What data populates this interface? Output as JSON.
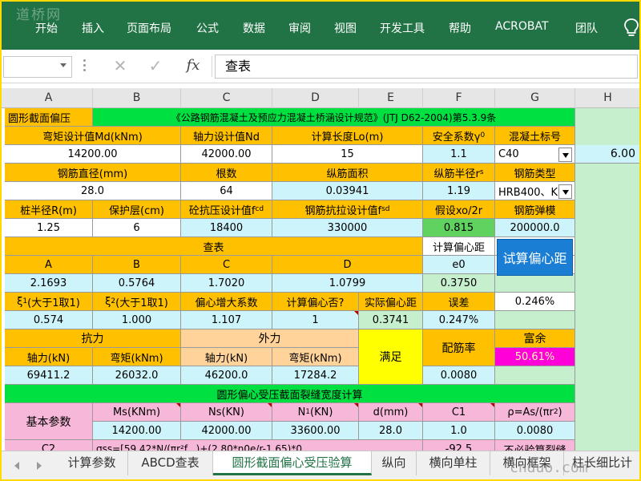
{
  "ribbon": {
    "watermark": "道桥网",
    "tabs": [
      "开始",
      "插入",
      "页面布局",
      "公式",
      "数据",
      "审阅",
      "视图",
      "开发工具",
      "帮助",
      "ACROBAT",
      "团队"
    ]
  },
  "formula_bar": {
    "name_box": "",
    "cancel_icon": "✕",
    "enter_icon": "✓",
    "fx_label": "fx",
    "formula": "查表"
  },
  "columns": [
    "A",
    "B",
    "C",
    "D",
    "E",
    "F",
    "G",
    "H"
  ],
  "cells": {
    "r1": {
      "a": "圆形截面偏压",
      "title": "《公路钢筋混凝土及预应力混凝土桥涵设计规范》(JTJ D62-2004)第5.3.9条"
    },
    "r2": {
      "a": "弯矩设计值Md(kNm)",
      "c": "轴力设计值Nd",
      "d": "计算长度Lo(m)",
      "f": "安全系数γ",
      "f_sub": "0",
      "g": "混凝土标号"
    },
    "r3": {
      "a": "14200.00",
      "c": "42000.00",
      "d": "15",
      "f": "1.1",
      "g": "C40",
      "h": "6.00"
    },
    "r4": {
      "a": "钢筋直径(mm)",
      "c": "根数",
      "d": "纵筋面积",
      "f": "纵筋半径r",
      "f_sub": "s",
      "g": "钢筋类型"
    },
    "r5": {
      "a": "28.0",
      "c": "64",
      "d": "0.03941",
      "f": "1.19",
      "g": "HRB400、K"
    },
    "r6": {
      "a": "桩半径R(m)",
      "b": "保护层(cm)",
      "c": "砼抗压设计值f",
      "c_sub": "cd",
      "d": "钢筋抗拉设计值f",
      "d_sub": "sd",
      "f": "假设xo/2r",
      "g": "钢筋弹模"
    },
    "r7": {
      "a": "1.25",
      "b": "6",
      "c": "18400",
      "d": "330000",
      "f": "0.815",
      "g": "200000.0"
    },
    "r8": {
      "a": "查表",
      "f": "计算偏心距"
    },
    "r9": {
      "a": "A",
      "b": "B",
      "c": "C",
      "d": "D",
      "f": "e0"
    },
    "r10": {
      "a": "2.1693",
      "b": "0.5764",
      "c": "1.7020",
      "d": "1.0799",
      "f": "0.3750"
    },
    "r11": {
      "a": "ξ",
      "a_sub": "1",
      "a_tail": "(大于1取1)",
      "b": "ξ",
      "b_sub": "2",
      "b_tail": "(大于1取1)",
      "c": "偏心增大系数",
      "d": "计算偏心否?",
      "e": "实际偏心距",
      "f": "误差",
      "g": "0.246%"
    },
    "r12": {
      "a": "0.574",
      "b": "1.000",
      "c": "1.107",
      "d": "1",
      "e": "0.3741",
      "f": "0.247%"
    },
    "r13": {
      "a": "抗力",
      "c": "外力",
      "e": "满足",
      "f": "配筋率",
      "g": "富余"
    },
    "r14": {
      "a": "轴力(kN)",
      "b": "弯矩(kNm)",
      "c": "轴力(kN)",
      "d": "弯矩(kNm)",
      "g": "50.61%"
    },
    "r15": {
      "a": "69411.2",
      "b": "26032.0",
      "c": "46200.0",
      "d": "17284.2",
      "f": "0.0080"
    },
    "r16": {
      "a": "圆形偏心受压截面裂缝宽度计算"
    },
    "r17": {
      "a": "基本参数",
      "b": "Ms(KNm)",
      "c": "Ns(KN)",
      "d": "N",
      "d_sub": "1",
      "d_tail": "(KN)",
      "e": "d(mm)",
      "f": "C1",
      "g": "ρ=As/(πr",
      "g_sup": "2",
      "g_tail": ")"
    },
    "r18": {
      "b": "14200.00",
      "c": "42000.00",
      "d": "33600.00",
      "e": "28.0",
      "f": "1.0",
      "g": "0.0080"
    },
    "r19": {
      "a": "C2",
      "b": "σss=[59.42*N/(πr²f...)+(2.80*η0e/r-1.65)*0.",
      "f": "-92.5",
      "g": "不必验算裂缝"
    }
  },
  "button": {
    "label": "试算偏心距"
  },
  "sheet_tabs": [
    "计算参数",
    "ABCD查表",
    "圆形截面偏心受压验算",
    "纵向",
    "横向单柱",
    "横向框架",
    "柱长细比计"
  ],
  "active_sheet": "圆形截面偏心受压验算",
  "site_watermark": "cnduo.com",
  "colors": {
    "ribbon": "#217346",
    "orange": "#ffc000",
    "green": "#00e040",
    "cyan": "#cdf3fb",
    "pink": "#f6b7d8",
    "yellow": "#ffff00",
    "magenta": "#ff00d9"
  }
}
